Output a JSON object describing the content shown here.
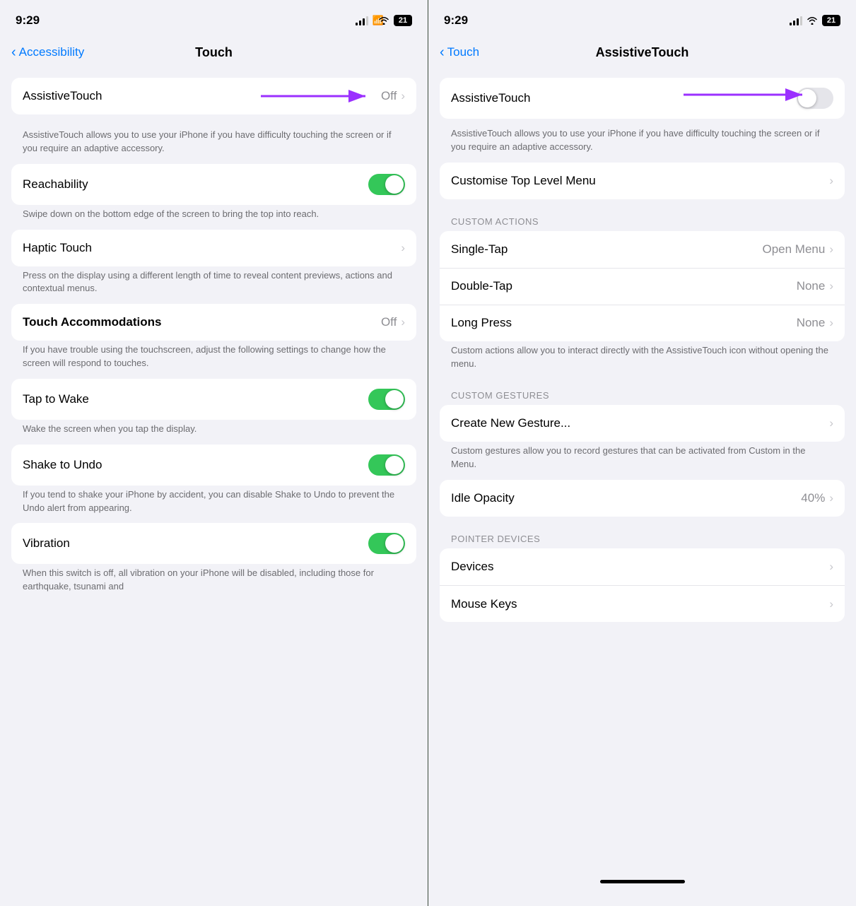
{
  "left": {
    "status": {
      "time": "9:29",
      "battery": "21"
    },
    "nav": {
      "back_label": "Accessibility",
      "title": "Touch"
    },
    "items": [
      {
        "id": "assistive-touch",
        "label": "AssistiveTouch",
        "value": "Off",
        "type": "nav",
        "description": "AssistiveTouch allows you to use your iPhone if you have difficulty touching the screen or if you require an adaptive accessory."
      },
      {
        "id": "reachability",
        "label": "Reachability",
        "value": null,
        "type": "toggle",
        "toggle_on": true,
        "description": "Swipe down on the bottom edge of the screen to bring the top into reach."
      },
      {
        "id": "haptic-touch",
        "label": "Haptic Touch",
        "value": null,
        "type": "nav",
        "description": "Press on the display using a different length of time to reveal content previews, actions and contextual menus."
      },
      {
        "id": "touch-accommodations",
        "label": "Touch Accommodations",
        "value": "Off",
        "type": "nav",
        "description": "If you have trouble using the touchscreen, adjust the following settings to change how the screen will respond to touches."
      },
      {
        "id": "tap-to-wake",
        "label": "Tap to Wake",
        "value": null,
        "type": "toggle",
        "toggle_on": true,
        "description": "Wake the screen when you tap the display."
      },
      {
        "id": "shake-to-undo",
        "label": "Shake to Undo",
        "value": null,
        "type": "toggle",
        "toggle_on": true,
        "description": "If you tend to shake your iPhone by accident, you can disable Shake to Undo to prevent the Undo alert from appearing."
      },
      {
        "id": "vibration",
        "label": "Vibration",
        "value": null,
        "type": "toggle",
        "toggle_on": true,
        "description": "When this switch is off, all vibration on your iPhone will be disabled, including those for earthquake, tsunami and"
      }
    ]
  },
  "right": {
    "status": {
      "time": "9:29",
      "battery": "21"
    },
    "nav": {
      "back_label": "Touch",
      "title": "AssistiveTouch"
    },
    "top_section": {
      "label": "AssistiveTouch",
      "toggle_on": false,
      "description": "AssistiveTouch allows you to use your iPhone if you have difficulty touching the screen or if you require an adaptive accessory."
    },
    "menu_section": {
      "label": "Customise Top Level Menu"
    },
    "custom_actions": {
      "header": "CUSTOM ACTIONS",
      "items": [
        {
          "label": "Single-Tap",
          "value": "Open Menu"
        },
        {
          "label": "Double-Tap",
          "value": "None"
        },
        {
          "label": "Long Press",
          "value": "None"
        }
      ],
      "description": "Custom actions allow you to interact directly with the AssistiveTouch icon without opening the menu."
    },
    "custom_gestures": {
      "header": "CUSTOM GESTURES",
      "items": [
        {
          "label": "Create New Gesture..."
        }
      ],
      "description": "Custom gestures allow you to record gestures that can be activated from Custom in the Menu."
    },
    "idle_opacity": {
      "label": "Idle Opacity",
      "value": "40%"
    },
    "pointer_devices": {
      "header": "POINTER DEVICES",
      "items": [
        {
          "label": "Devices"
        },
        {
          "label": "Mouse Keys"
        }
      ]
    }
  }
}
